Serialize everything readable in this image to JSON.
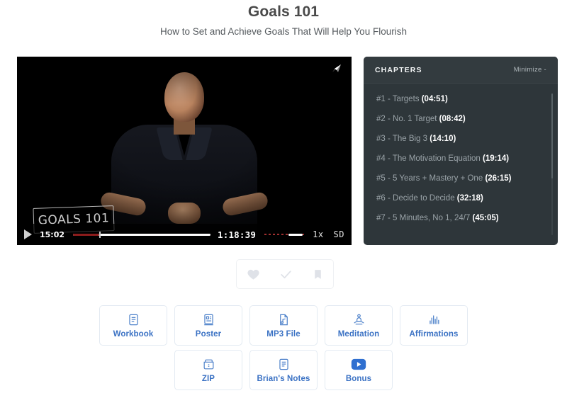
{
  "header": {
    "title": "Goals 101",
    "subtitle": "How to Set and Achieve Goals That Will Help You Flourish"
  },
  "player": {
    "expand_icon": "expand-arrow-icon",
    "play_icon": "play-icon",
    "current_time": "15:02",
    "total_time": "1:18:39",
    "speed": "1x",
    "quality": "SD",
    "progress_percent": 19,
    "volume_percent": 61,
    "whiteboard_text": "GOALS 101",
    "played_color": "#8d1c1c",
    "remaining_color": "#ffffff"
  },
  "chapters": {
    "title": "CHAPTERS",
    "minimize_label": "Minimize -",
    "panel_color": "#2e363a",
    "items": [
      {
        "label": "#1 - Targets",
        "time": "(04:51)"
      },
      {
        "label": "#2 - No. 1 Target",
        "time": "(08:42)"
      },
      {
        "label": "#3 - The Big 3",
        "time": "(14:10)"
      },
      {
        "label": "#4 - The Motivation Equation",
        "time": "(19:14)"
      },
      {
        "label": "#5 - 5 Years + Mastery + One",
        "time": "(26:15)"
      },
      {
        "label": "#6 - Decide to Decide",
        "time": "(32:18)"
      },
      {
        "label": "#7 - 5 Minutes, No 1, 24/7",
        "time": "(45:05)"
      }
    ]
  },
  "reactions": [
    {
      "name": "heart-icon"
    },
    {
      "name": "check-icon"
    },
    {
      "name": "bookmark-icon"
    }
  ],
  "downloads": {
    "accent_color": "#3b72c4",
    "row1": [
      {
        "label": "Workbook",
        "icon": "document-lines-icon"
      },
      {
        "label": "Poster",
        "icon": "poster-icon"
      },
      {
        "label": "MP3 File",
        "icon": "music-file-icon"
      },
      {
        "label": "Meditation",
        "icon": "meditation-icon"
      },
      {
        "label": "Affirmations",
        "icon": "bar-chart-icon"
      }
    ],
    "row2": [
      {
        "label": "ZIP",
        "icon": "zip-folder-icon"
      },
      {
        "label": "Brian's Notes",
        "icon": "notes-icon"
      },
      {
        "label": "Bonus",
        "icon": "play-badge-icon"
      }
    ]
  }
}
